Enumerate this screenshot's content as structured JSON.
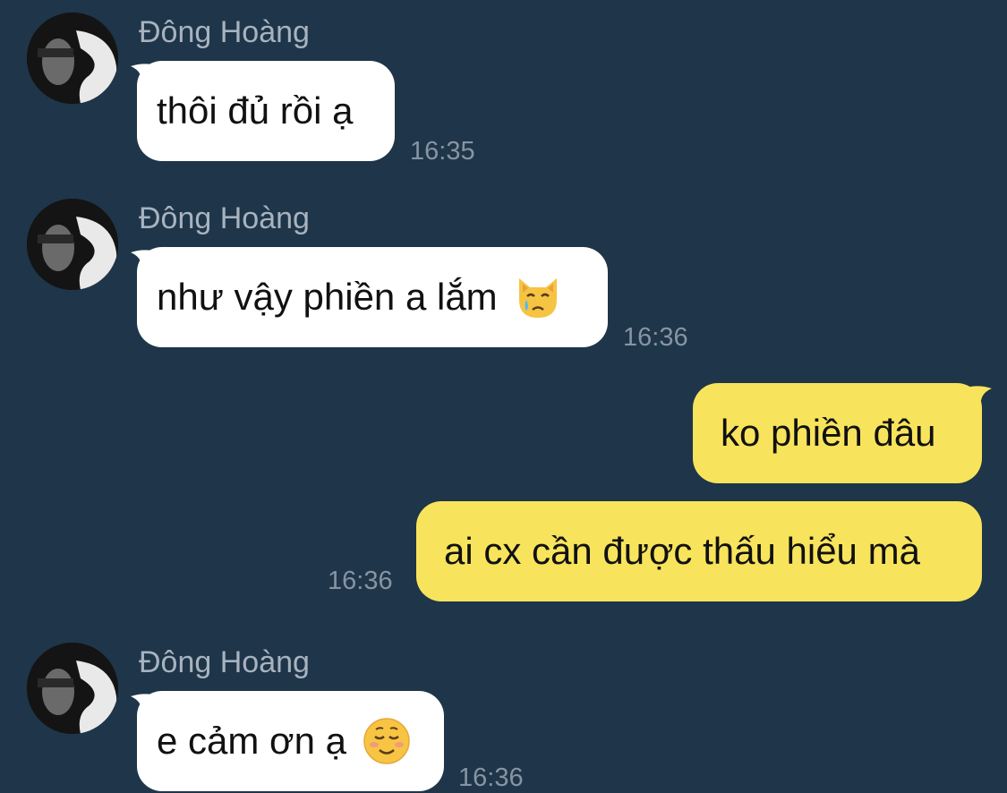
{
  "colors": {
    "background": "#1f3549",
    "incoming_bubble": "#ffffff",
    "outgoing_bubble": "#f8e45c",
    "sender_name": "#a7b3bf",
    "timestamp": "#8694a3"
  },
  "messages": [
    {
      "sender": "Đông Hoàng",
      "text": "thôi đủ rồi ạ",
      "time": "16:35",
      "direction": "incoming"
    },
    {
      "sender": "Đông Hoàng",
      "text": "như vậy phiền a lắm",
      "emoji": "crying-cat-face-icon",
      "time": "16:36",
      "direction": "incoming"
    },
    {
      "text": "ko phiền đâu",
      "direction": "outgoing"
    },
    {
      "text": "ai cx cần được thấu hiểu mà",
      "time": "16:36",
      "direction": "outgoing"
    },
    {
      "sender": "Đông Hoàng",
      "text": "e cảm ơn ạ",
      "emoji": "smiling-face-icon",
      "time": "16:36",
      "direction": "incoming"
    }
  ]
}
